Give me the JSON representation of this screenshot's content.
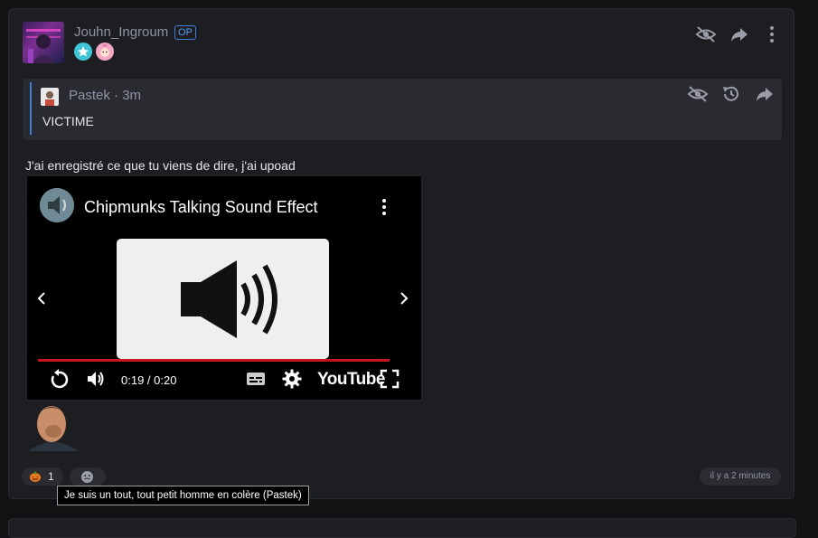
{
  "post": {
    "author": "Jouhn_Ingroum",
    "op_badge": "OP",
    "text": "J'ai enregistré ce que tu viens de dire, j'ai upoad",
    "timestamp": "il y a 2 minutes"
  },
  "header_actions": [
    "eye-slash-icon",
    "share-icon",
    "more-vertical-icon"
  ],
  "quote": {
    "author": "Pastek",
    "meta": "· 3m",
    "text": "VICTIME",
    "actions": [
      "eye-slash-icon",
      "history-icon",
      "share-icon"
    ]
  },
  "video": {
    "title": "Chipmunks Talking Sound Effect",
    "time": "0:19 / 0:20",
    "brand": "YouTube",
    "progress": 0.95,
    "accent_color": "#c4161c"
  },
  "reactions": [
    {
      "icon": "pumpkin-emoji-icon",
      "count": "1"
    },
    {
      "icon": "add-reaction-icon",
      "count": ""
    }
  ],
  "tooltip": "Je suis un tout, tout petit homme en colère (Pastek)"
}
